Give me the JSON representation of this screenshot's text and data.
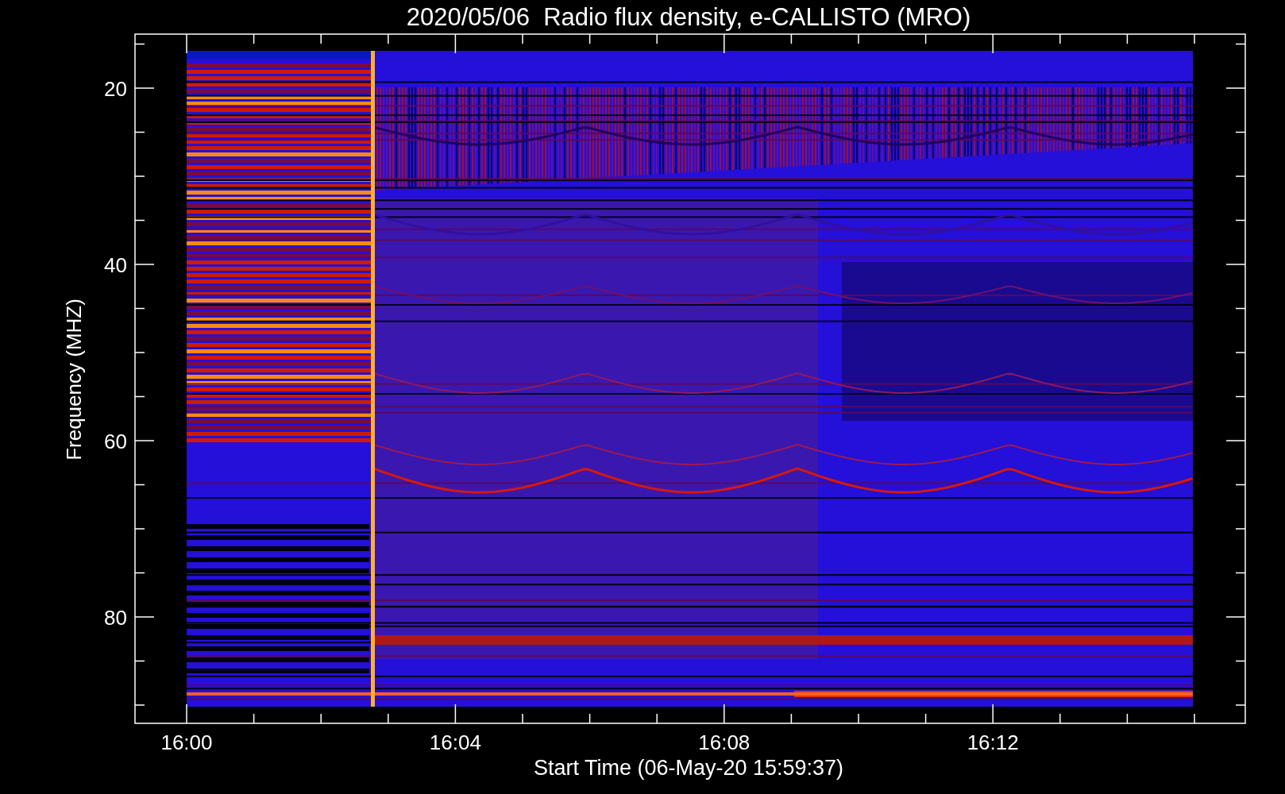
{
  "plot": {
    "title": "2020/05/06  Radio flux density, e-CALLISTO (MRO)",
    "x_axis": {
      "label": "Start Time (06-May-20 15:59:37)",
      "ticks": [
        "16:00",
        "16:04",
        "16:08",
        "16:12"
      ]
    },
    "y_axis": {
      "label": "Frequency (MHZ)",
      "ticks": [
        "20",
        "40",
        "60",
        "80"
      ]
    }
  }
}
